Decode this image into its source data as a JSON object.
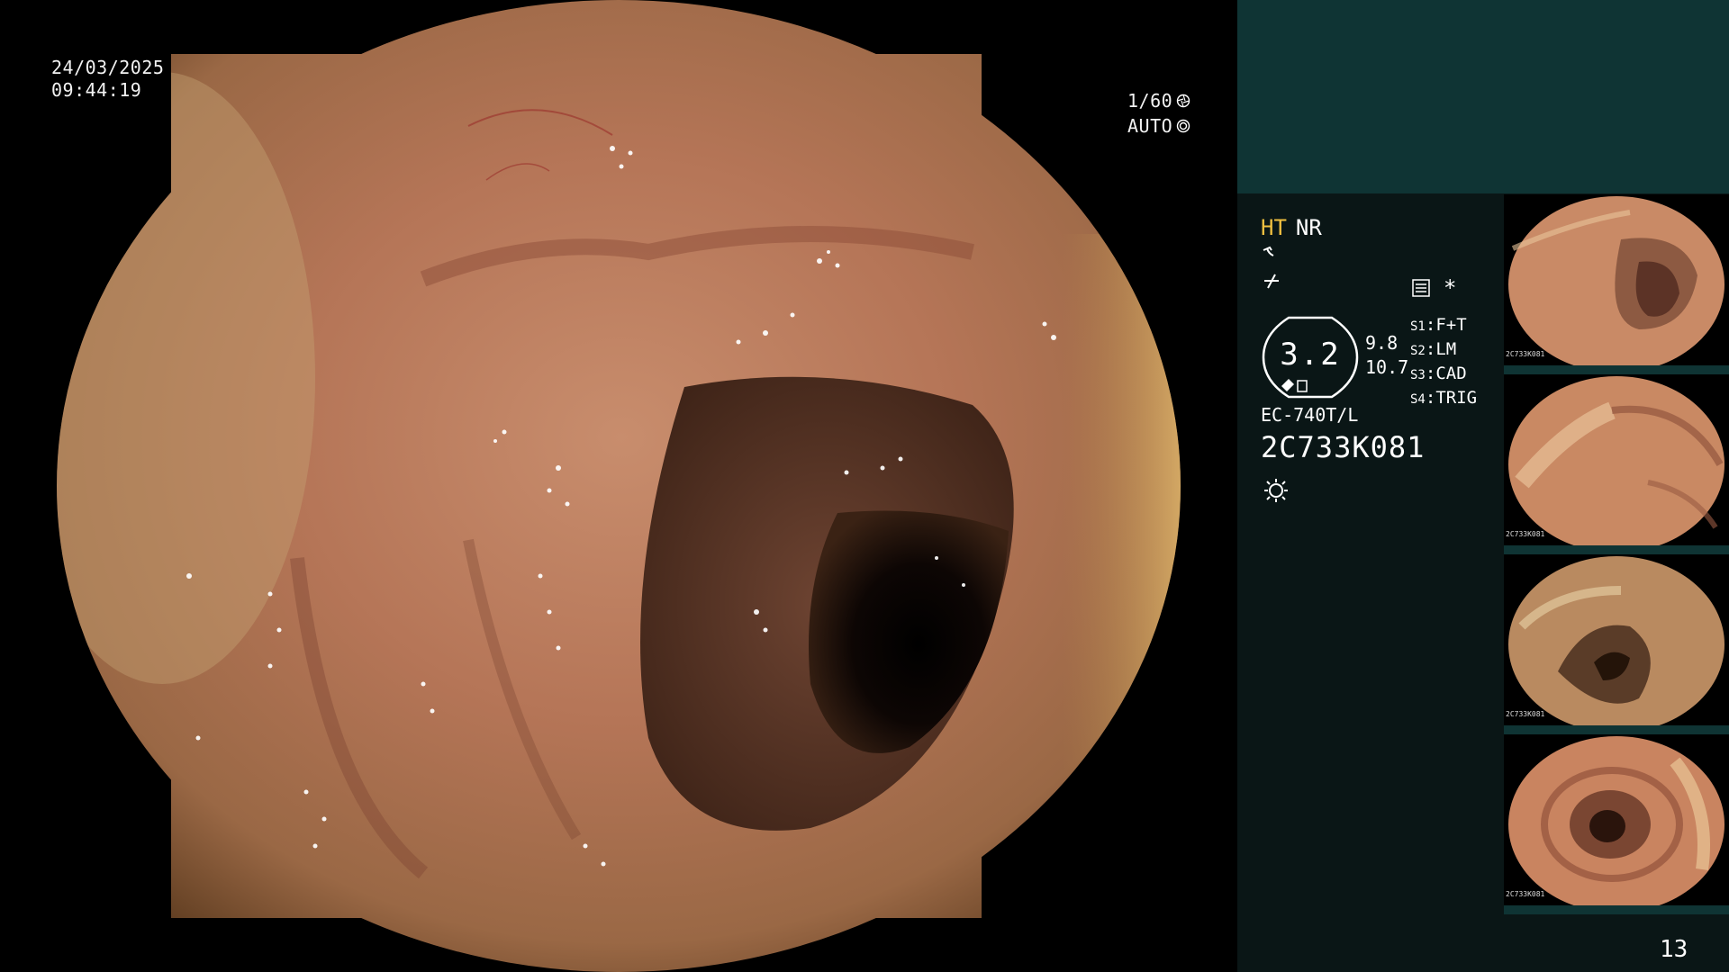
{
  "main": {
    "date": "24/03/2025",
    "time": "09:44:19",
    "shutter": "1/60",
    "iris_mode": "AUTO"
  },
  "panel": {
    "mode_ht": "HT",
    "mode_nr": "NR",
    "gauge_value": "3.2",
    "side_values": [
      "9.8",
      "10.7"
    ],
    "settings": [
      {
        "key": "S1",
        "value": "F+T"
      },
      {
        "key": "S2",
        "value": "LM"
      },
      {
        "key": "S3",
        "value": "CAD"
      },
      {
        "key": "S4",
        "value": "TRIG"
      }
    ],
    "scope_model": "EC-740T/L",
    "serial": "2C733K081",
    "icons": [
      "enhancement-icon",
      "sharpness-icon",
      "settings-list-icon",
      "asterisk-icon",
      "light-source-icon"
    ]
  },
  "thumbnails": [
    {
      "serial": "2C733K081"
    },
    {
      "serial": "2C733K081"
    },
    {
      "serial": "2C733K081"
    },
    {
      "serial": "2C733K081"
    }
  ],
  "page_number": "13",
  "colors": {
    "panel_background": "#0a1616",
    "panel_top": "#0f3434",
    "ht_label": "#f0c040"
  }
}
